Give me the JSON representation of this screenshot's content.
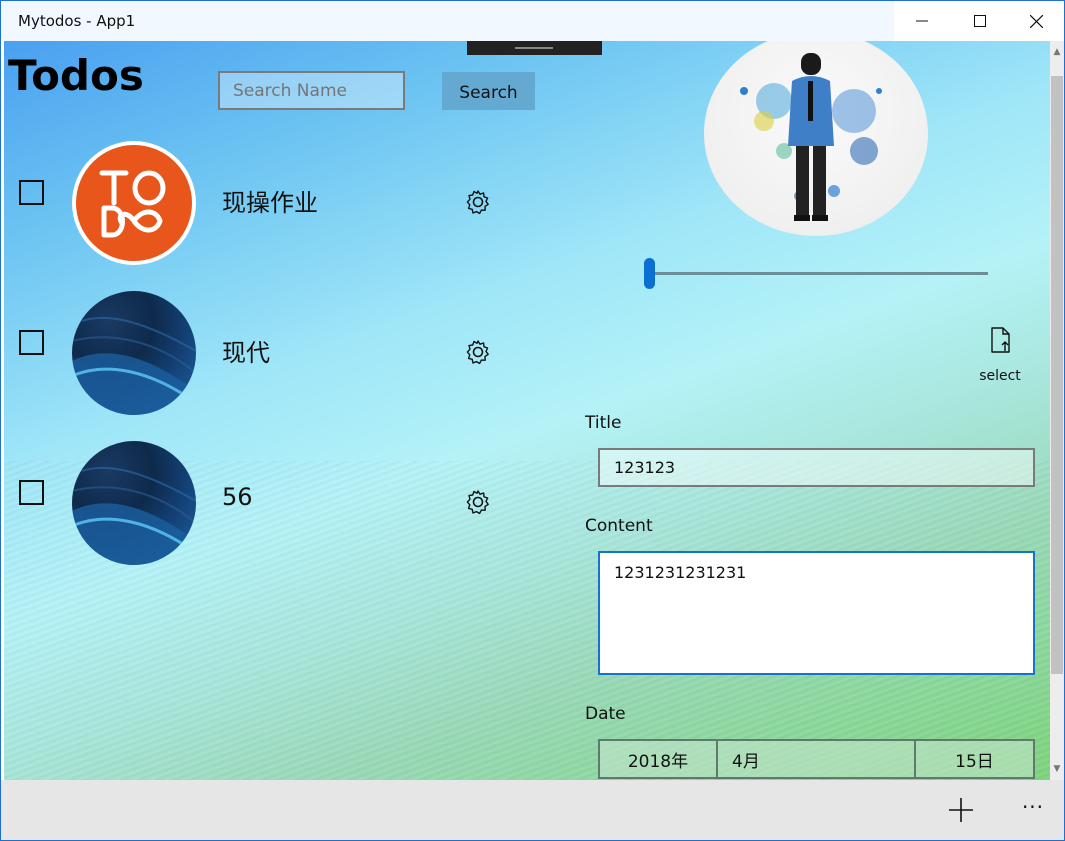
{
  "window": {
    "title": "Mytodos - App1"
  },
  "page": {
    "title": "Todos"
  },
  "search": {
    "placeholder": "Search Name",
    "button_label": "Search"
  },
  "todos": [
    {
      "label": "现操作业",
      "checked": false,
      "avatar": "todo-logo"
    },
    {
      "label": "现代",
      "checked": false,
      "avatar": "blue-wave"
    },
    {
      "label": "56",
      "checked": false,
      "avatar": "blue-wave"
    }
  ],
  "detail": {
    "select_label": "select",
    "slider_value": 0.0,
    "title_label": "Title",
    "title_value": "123123",
    "content_label": "Content",
    "content_value": "1231231231231",
    "date_label": "Date",
    "date": {
      "year": "2018年",
      "month": "4月",
      "day": "15日"
    }
  },
  "icons": {
    "checkbox": "checkbox-icon",
    "gear": "gear-icon",
    "file_upload": "file-upload-icon",
    "add": "add-icon",
    "more": "more-icon"
  },
  "colors": {
    "accent": "#0a6fd1",
    "todo_logo": "#e8561b",
    "search_button": "#64a9d2",
    "appbar": "#e6e6e6"
  }
}
